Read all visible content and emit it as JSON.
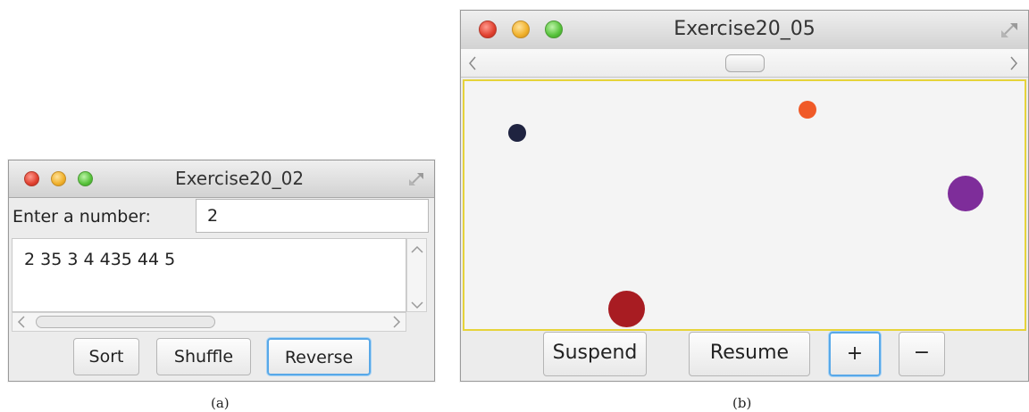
{
  "window_a": {
    "title": "Exercise20_02",
    "prompt_label": "Enter a number:",
    "number_input_value": "2",
    "list_text": "2 35 3 4 435 44 5",
    "buttons": {
      "sort": "Sort",
      "shuffle": "Shuffle",
      "reverse": "Reverse"
    },
    "focused_button": "reverse",
    "caption": "(a)"
  },
  "window_b": {
    "title": "Exercise20_05",
    "balls": [
      {
        "color": "#1f2340"
      },
      {
        "color": "#f05a28"
      },
      {
        "color": "#7e2d9a"
      },
      {
        "color": "#a81c22"
      }
    ],
    "canvas_border_color": "#e6d33a",
    "buttons": {
      "suspend": "Suspend",
      "resume": "Resume",
      "plus": "+",
      "minus": "−"
    },
    "focused_button": "plus",
    "caption": "(b)"
  }
}
